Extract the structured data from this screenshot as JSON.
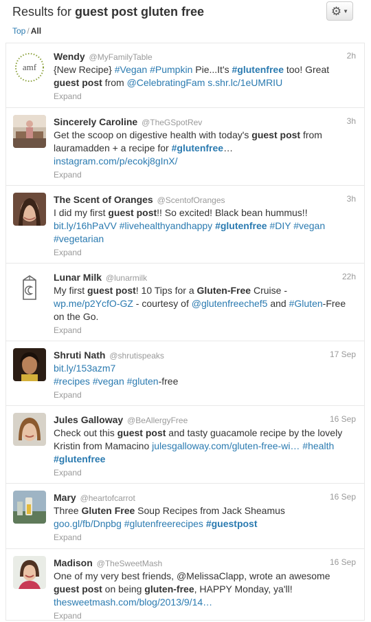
{
  "header": {
    "title_prefix": "Results for ",
    "query": "guest post gluten free",
    "nav_top": "Top",
    "nav_sep": "/",
    "nav_all": "All"
  },
  "icons": {
    "settings": "gear-icon",
    "dropdown": "caret-down-icon"
  },
  "colors": {
    "link": "#2a7ab0",
    "muted": "#999999",
    "text": "#333333",
    "divider": "#e8e8e8"
  },
  "expand_label": "Expand",
  "tweets": [
    {
      "name": "Wendy",
      "handle": "@MyFamilyTable",
      "time": "2h",
      "avatar": "amf-logo",
      "parts": {
        "p1": "{New Recipe} ",
        "h1": "#Vegan",
        "s1": " ",
        "h2": "#Pumpkin",
        "p2": " Pie...It's ",
        "h3": "#glutenfree",
        "p3": " too!  Great ",
        "b1": "guest post",
        "p4": " from ",
        "m1": "@CelebratingFam",
        "s2": "  ",
        "l1": "s.shr.lc/1eUMRIU"
      }
    },
    {
      "name": "Sincerely Caroline",
      "handle": "@TheGSpotRev",
      "time": "3h",
      "parts": {
        "p1": "Get the scoop on digestive health with today's ",
        "b1": "guest post",
        "p2": " from lauramadden + a recipe for ",
        "h1": "#glutenfree",
        "p3": "…",
        "l1": "instagram.com/p/ecokj8gInX/"
      }
    },
    {
      "name": "The Scent of Oranges",
      "handle": "@ScentofOranges",
      "time": "3h",
      "parts": {
        "p1": "I did my first ",
        "b1": "guest post",
        "p2": "!! So excited!  Black bean hummus!! ",
        "l1": "bit.ly/16hPaVV",
        "h1": "#livehealthyandhappy",
        "h2": "#glutenfree",
        "h3": "#DIY",
        "h4": "#vegan",
        "h5": "#vegetarian"
      }
    },
    {
      "name": "Lunar Milk",
      "handle": "@lunarmilk",
      "time": "22h",
      "parts": {
        "p1": "My first ",
        "b1": "guest post",
        "p2": "! 10 Tips for a ",
        "b2": "Gluten-Free",
        "p3": " Cruise - ",
        "l1": "wp.me/p2YcfO-GZ",
        "p4": " - courtesy of ",
        "m1": "@glutenfreechef5",
        "p5": " and ",
        "h1": "#Gluten",
        "p6": "-Free on the Go."
      }
    },
    {
      "name": "Shruti Nath",
      "handle": "@shrutispeaks",
      "time": "17 Sep",
      "parts": {
        "l1": "bit.ly/153azm7",
        "h1": "#recipes",
        "h2": "#vegan",
        "h3": "#gluten",
        "p1": "-free"
      }
    },
    {
      "name": "Jules Galloway",
      "handle": "@BeAllergyFree",
      "time": "16 Sep",
      "parts": {
        "p1": "Check out this ",
        "b1": "guest post",
        "p2": " and tasty guacamole recipe by the lovely Kristin from Mamacino ",
        "l1": "julesgalloway.com/gluten-free-wi…",
        "h1": "#health",
        "h2": "#glutenfree"
      }
    },
    {
      "name": "Mary",
      "handle": "@heartofcarrot",
      "time": "16 Sep",
      "parts": {
        "p1": "Three ",
        "b1": "Gluten Free",
        "p2": " Soup Recipes from Jack Sheamus ",
        "l1": "goo.gl/fb/Dnpbg",
        "h1": "#glutenfreerecipes",
        "h2": "#guestpost"
      }
    },
    {
      "name": "Madison",
      "handle": "@TheSweetMash",
      "time": "16 Sep",
      "parts": {
        "p1": "One of my very best friends, @MelissaClapp, wrote an awesome ",
        "b1": "guest post",
        "p2": " on being ",
        "b2": "gluten-free",
        "p3": ", HAPPY Monday, ya'll! ",
        "l1": "thesweetmash.com/blog/2013/9/14…"
      }
    }
  ]
}
